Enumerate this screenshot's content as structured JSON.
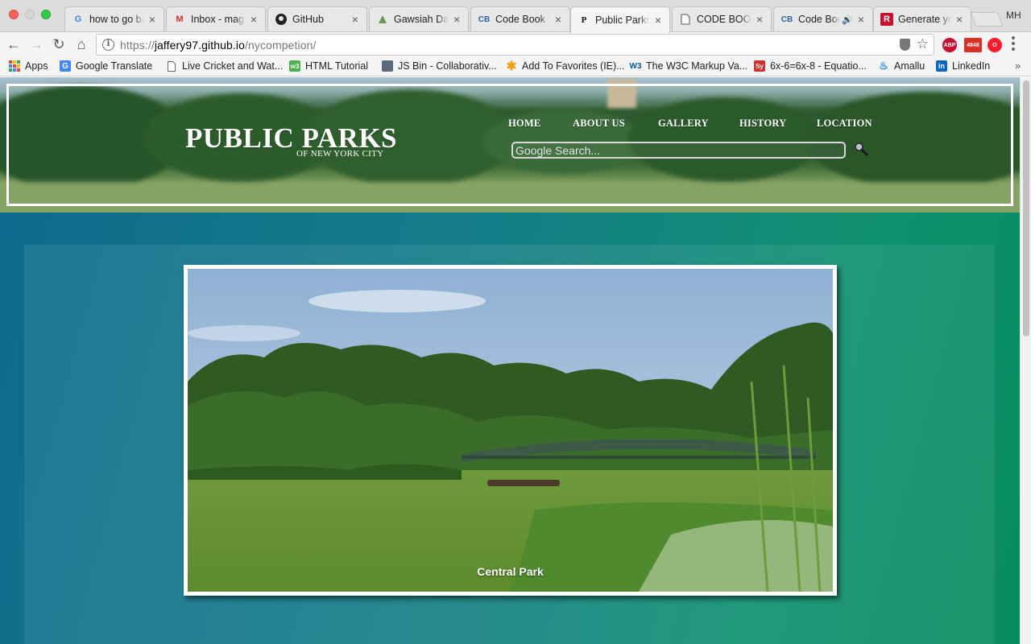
{
  "browser": {
    "tabs": [
      {
        "title": "how to go back",
        "favicon": "google-icon"
      },
      {
        "title": "Inbox - magfaz",
        "favicon": "gmail-icon"
      },
      {
        "title": "GitHub",
        "favicon": "github-icon"
      },
      {
        "title": "Gawsiah Dar",
        "favicon": "site-icon"
      },
      {
        "title": "Code Book Te",
        "favicon": "codebook-icon"
      },
      {
        "title": "Public Parks",
        "favicon": "publicparks-icon",
        "active": true
      },
      {
        "title": "CODE BOOK",
        "favicon": "document-icon"
      },
      {
        "title": "Code Book",
        "favicon": "codebook-icon",
        "audio": true
      },
      {
        "title": "Generate yo",
        "favicon": "r-icon"
      }
    ],
    "profile": "MH",
    "url": {
      "scheme": "https://",
      "host": "jaffery97.github.io",
      "path": "/nycompetion/"
    },
    "extensions": {
      "abp": "ABP",
      "mail_count": "4848"
    },
    "bookmarks": [
      {
        "label": "Apps",
        "icon": "apps-grid-icon"
      },
      {
        "label": "Google Translate",
        "icon": "translate-icon"
      },
      {
        "label": "Live Cricket and Wat...",
        "icon": "page-icon"
      },
      {
        "label": "HTML Tutorial",
        "icon": "w3-icon"
      },
      {
        "label": "JS Bin - Collaborativ...",
        "icon": "jsbin-icon"
      },
      {
        "label": "Add To Favorites (IE)...",
        "icon": "asterisk-icon"
      },
      {
        "label": "The W3C Markup Va...",
        "icon": "w3c-icon"
      },
      {
        "label": "6x-6=6x-8 - Equatio...",
        "icon": "symbolab-icon"
      },
      {
        "label": "Amallu",
        "icon": "amallu-icon"
      },
      {
        "label": "LinkedIn",
        "icon": "linkedin-icon"
      }
    ]
  },
  "site": {
    "logo": {
      "title": "PUBLIC PARKS",
      "subtitle": "OF NEW YORK CITY"
    },
    "nav": [
      "HOME",
      "ABOUT US",
      "GALLERY",
      "HISTORY",
      "LOCATION"
    ],
    "search": {
      "placeholder": "Google Search..."
    },
    "gallery": {
      "caption": "Central Park"
    }
  },
  "colors": {
    "page_gradient_start": "#0d6a8e",
    "page_gradient_end": "#078c5d",
    "frame": "#ffffff"
  }
}
